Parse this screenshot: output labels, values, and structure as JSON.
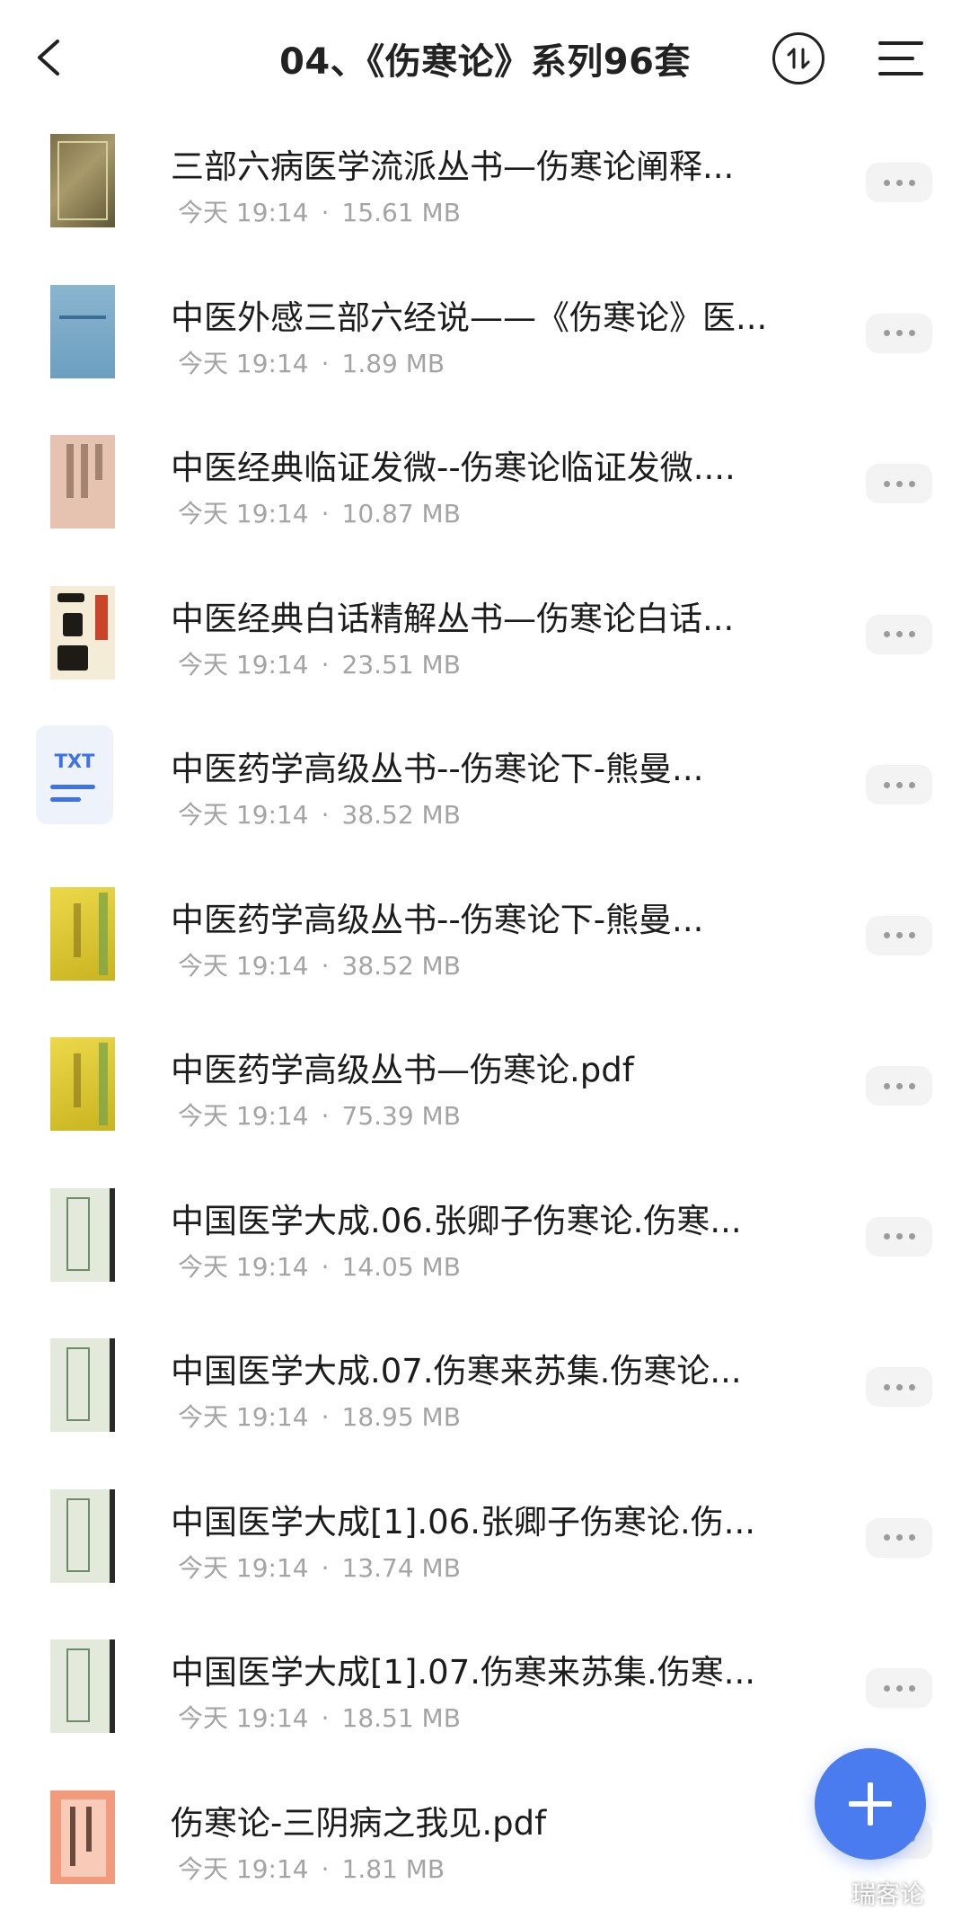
{
  "header": {
    "title": "04、《伤寒论》系列96套"
  },
  "files": [
    {
      "name": "三部六病医学流派丛书—伤寒论阐释...",
      "date": "今天 19:14",
      "size": "15.61 MB",
      "thumb": "brown"
    },
    {
      "name": "中医外感三部六经说——《伤寒论》医...",
      "date": "今天 19:14",
      "size": "1.89 MB",
      "thumb": "blue"
    },
    {
      "name": "中医经典临证发微--伤寒论临证发微....",
      "date": "今天 19:14",
      "size": "10.87 MB",
      "thumb": "peach"
    },
    {
      "name": "中医经典白话精解丛书—伤寒论白话...",
      "date": "今天 19:14",
      "size": "23.51 MB",
      "thumb": "callig"
    },
    {
      "name": "中医药学高级丛书--伤寒论下-熊曼...",
      "date": "今天 19:14",
      "size": "38.52 MB",
      "thumb": "txt",
      "thumb_label": "TXT"
    },
    {
      "name": "中医药学高级丛书--伤寒论下-熊曼...",
      "date": "今天 19:14",
      "size": "38.52 MB",
      "thumb": "yellow"
    },
    {
      "name": "中医药学高级丛书—伤寒论.pdf",
      "date": "今天 19:14",
      "size": "75.39 MB",
      "thumb": "yellow"
    },
    {
      "name": "中国医学大成.06.张卿子伤寒论.伤寒...",
      "date": "今天 19:14",
      "size": "14.05 MB",
      "thumb": "green"
    },
    {
      "name": "中国医学大成.07.伤寒来苏集.伤寒论...",
      "date": "今天 19:14",
      "size": "18.95 MB",
      "thumb": "green"
    },
    {
      "name": "中国医学大成[1].06.张卿子伤寒论.伤...",
      "date": "今天 19:14",
      "size": "13.74 MB",
      "thumb": "green"
    },
    {
      "name": "中国医学大成[1].07.伤寒来苏集.伤寒...",
      "date": "今天 19:14",
      "size": "18.51 MB",
      "thumb": "green"
    },
    {
      "name": "伤寒论-三阴病之我见.pdf",
      "date": "今天 19:14",
      "size": "1.81 MB",
      "thumb": "orange"
    }
  ],
  "meta_separator": "·",
  "icons": {
    "back": "chevron-left-icon",
    "sort": "sort-icon",
    "menu": "menu-icon",
    "more": "more-dots-icon",
    "add": "plus-icon"
  },
  "colors": {
    "accent": "#4a7cf0",
    "meta_text": "#a4a4a4"
  },
  "watermark": "瑞客论"
}
